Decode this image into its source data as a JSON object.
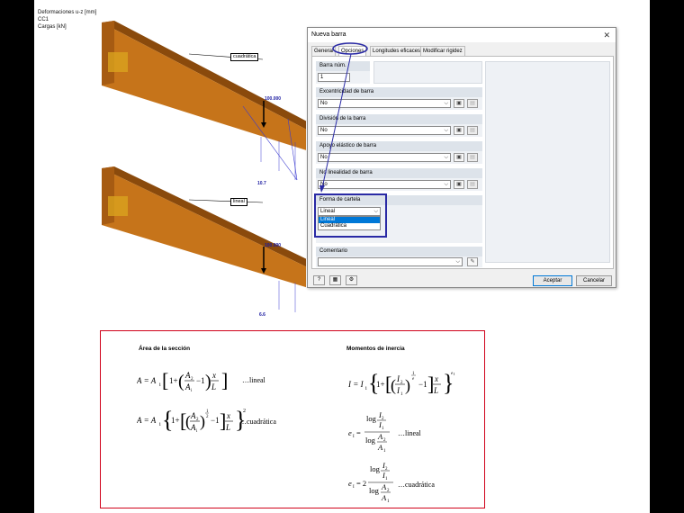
{
  "viewport": {
    "lines": [
      "Deformaciones u-z [mm]",
      "CC1",
      "Cargas [kN]"
    ],
    "beam_top": {
      "label": "cuadrática",
      "load_value": "100.000",
      "deflection_value": "10.7"
    },
    "beam_bottom": {
      "label": "lineal",
      "load_value": "100.000",
      "deflection_value": "6.6"
    }
  },
  "dialog": {
    "title": "Nueva barra",
    "close_glyph": "✕",
    "tabs": [
      "General",
      "Opciones",
      "Longitudes eficaces",
      "Modificar rigidez"
    ],
    "active_tab": "Opciones",
    "barra_num_label": "Barra núm.",
    "barra_num_value": "1",
    "groups": [
      {
        "label": "Excentricidad de barra",
        "value": "No"
      },
      {
        "label": "División de la barra",
        "value": "No"
      },
      {
        "label": "Apoyo elástico de barra",
        "value": "No"
      },
      {
        "label": "No linealidad de barra",
        "value": "No"
      }
    ],
    "taper": {
      "label": "Forma de cartela",
      "value": "Lineal",
      "options": [
        "Lineal",
        "Cuadrática"
      ],
      "selected_option": "Lineal"
    },
    "comment_label": "Comentario",
    "comment_value": "",
    "ok_label": "Aceptar",
    "cancel_label": "Cancelar",
    "colors": {
      "accent": "#0078d7",
      "highlight": "#2a2aa5",
      "group_header": "#dde3ea"
    }
  },
  "formulas": {
    "area_heading": "Área de la sección",
    "inertia_heading": "Momentos de inercia",
    "lineal_suffix": "…lineal",
    "quadratic_suffix": "…cuadrática",
    "border_color": "#d0021b"
  }
}
